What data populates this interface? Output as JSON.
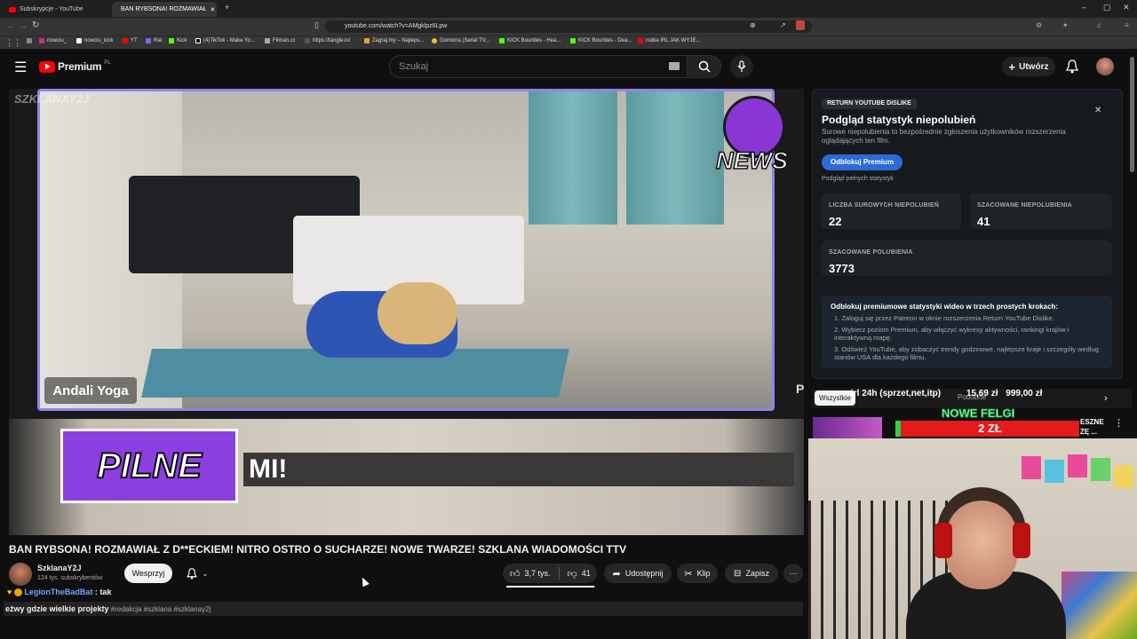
{
  "browser": {
    "tabs": [
      {
        "title": "Subskrypcje - YouTube",
        "active": false
      },
      {
        "title": "BAN RYBSONA! ROZMAWIAŁ",
        "active": true
      }
    ],
    "url": "youtube.com/watch?v=AMgklpz6Lpw",
    "bookmarks": [
      "nowciu_",
      "nowciu_kick",
      "YT",
      "Rat",
      "Kick",
      "(4)TikTok - Make Yo...",
      "Filman.cc",
      "https://tangle.io/",
      "Zagraj.my – Najleps...",
      "Gomorra (Serial TV...",
      "KICK Bounties - Hea...",
      "KICK Bounties - Dea...",
      "nutka IRL JAK WYJE..."
    ]
  },
  "header": {
    "logo": "Premium",
    "region": "PL",
    "search_placeholder": "Szukaj",
    "create_label": "Utwórz"
  },
  "video": {
    "watermark": "SZKLANAY2J",
    "yoga_label": "Andali Yoga",
    "news_logo_text": "NEWS",
    "pilne_label": "PILNE",
    "ticker": "MI!",
    "edge_letter": "P"
  },
  "info": {
    "title": "BAN RYBSONA! ROZMAWIAŁ Z D**ECKIEM! NITRO OSTRO O SUCHARZE! NOWE TWARZE! SZKLANA WIADOMOŚCI TTV",
    "channel": "SzklanaY2J",
    "subscribers": "124 tys. subskrybentów",
    "support_label": "Wesprzyj",
    "likes": "3,7 tys.",
    "dislikes": "41",
    "share_label": "Udostępnij",
    "clip_label": "Klip",
    "save_label": "Zapisz",
    "chat_user": "LegionTheBadBat",
    "chat_message": ": tak",
    "desc_overlay": "eźwy gdzie wielkie projekty",
    "hashtags": "#redakcja #szklana #szklanay2j"
  },
  "panel": {
    "tag": "RETURN YOUTUBE DISLIKE",
    "title": "Podgląd statystyk niepolubień",
    "desc": "Surowe niepolubienia to bezpośrednie zgłoszenia użytkowników rozszerzenia oglądających ten film.",
    "unlock_label": "Odblokuj Premium",
    "full_stats": "Podgląd pełnych statystyk",
    "stats": [
      {
        "label": "LICZBA SUROWYCH NIEPOLUBIEŃ",
        "value": "22"
      },
      {
        "label": "SZACOWANE NIEPOLUBIENIA",
        "value": "41"
      },
      {
        "label": "SZACOWANE POLUBIENIA",
        "value": "3773"
      }
    ],
    "steps_title": "Odblokuj premiumowe statystyki wideo w trzech prostych krokach:",
    "steps": [
      "1.  Zaloguj się przez Patreon w oknie rozszerzenia Return YouTube Dislike.",
      "2.  Wybierz poziom Premium, aby włączyć wykresy aktywności, rankingi krajów i interaktywną mapę.",
      "3.  Odśwież YouTube, aby zobaczyć trendy godzinowe, najlepsze kraje i szczegóły według stanów USA dla każdego filmu."
    ]
  },
  "side": {
    "chip_all": "Wszystkie",
    "chip_more": "Podobne",
    "ad_text": "irl 24h (sprzet,net,itp)",
    "ad_price1": "15,69 zł",
    "ad_price2": "999,00 zł",
    "felgi": "NOWE FELGI",
    "felgi_price": "2 ZŁ",
    "side_text1": "ESZNE",
    "side_text2": "ZĘ ..."
  }
}
